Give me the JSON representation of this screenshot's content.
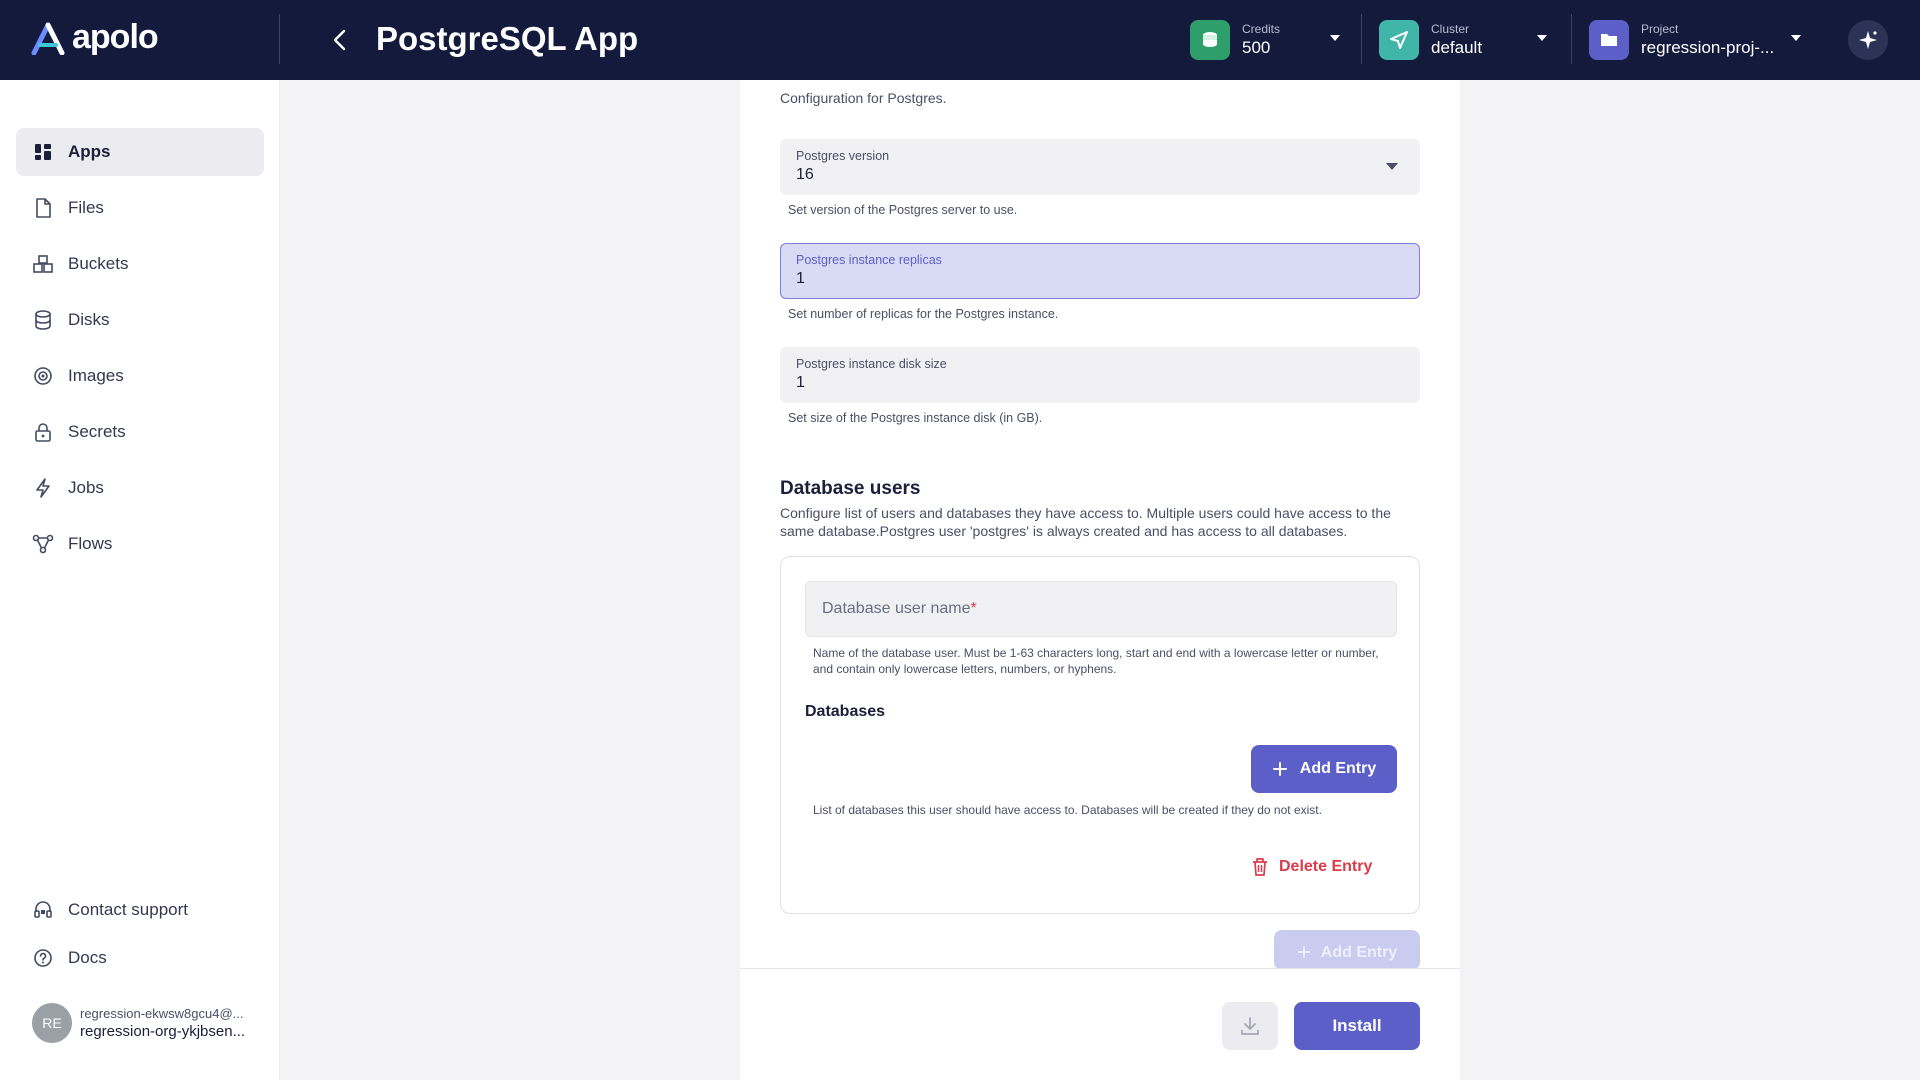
{
  "header": {
    "logo_text": "apolo",
    "title": "PostgreSQL App",
    "credits": {
      "label": "Credits",
      "value": "500",
      "color": "#2e9e6b"
    },
    "cluster": {
      "label": "Cluster",
      "value": "default",
      "color": "#3fb6a8"
    },
    "project": {
      "label": "Project",
      "value": "regression-proj-...",
      "color": "#5b5fc7"
    }
  },
  "sidebar": {
    "items": [
      {
        "label": "Apps",
        "icon": "apps-grid-icon",
        "active": true
      },
      {
        "label": "Files",
        "icon": "file-icon"
      },
      {
        "label": "Buckets",
        "icon": "buckets-icon"
      },
      {
        "label": "Disks",
        "icon": "database-icon"
      },
      {
        "label": "Images",
        "icon": "image-icon"
      },
      {
        "label": "Secrets",
        "icon": "lock-icon"
      },
      {
        "label": "Jobs",
        "icon": "bolt-icon"
      },
      {
        "label": "Flows",
        "icon": "flow-icon"
      }
    ],
    "footer": [
      {
        "label": "Contact support",
        "icon": "headset-icon"
      },
      {
        "label": "Docs",
        "icon": "help-circle-icon"
      }
    ],
    "user": {
      "initials": "RE",
      "email": "regression-ekwsw8gcu4@...",
      "org": "regression-org-ykjbsen..."
    }
  },
  "form": {
    "config_desc": "Configuration for Postgres.",
    "version": {
      "label": "Postgres version",
      "value": "16",
      "help": "Set version of the Postgres server to use."
    },
    "replicas": {
      "label": "Postgres instance replicas",
      "value": "1",
      "help": "Set number of replicas for the Postgres instance."
    },
    "disk": {
      "label": "Postgres instance disk size",
      "value": "1",
      "help": "Set size of the Postgres instance disk (in GB)."
    },
    "db_users": {
      "title": "Database users",
      "desc": "Configure list of users and databases they have access to. Multiple users could have access to the same database.Postgres user 'postgres' is always created and has access to all databases.",
      "user_name_placeholder": "Database user name",
      "required_mark": "*",
      "user_name_help": "Name of the database user. Must be 1-63 characters long, start and end with a lowercase letter or number, and contain only lowercase letters, numbers, or hyphens.",
      "databases_title": "Databases",
      "add_entry": "Add Entry",
      "databases_help": "List of databases this user should have access to. Databases will be created if they do not exist.",
      "delete_entry": "Delete Entry",
      "add_entry_outer": "Add Entry"
    }
  },
  "footer": {
    "install": "Install"
  }
}
